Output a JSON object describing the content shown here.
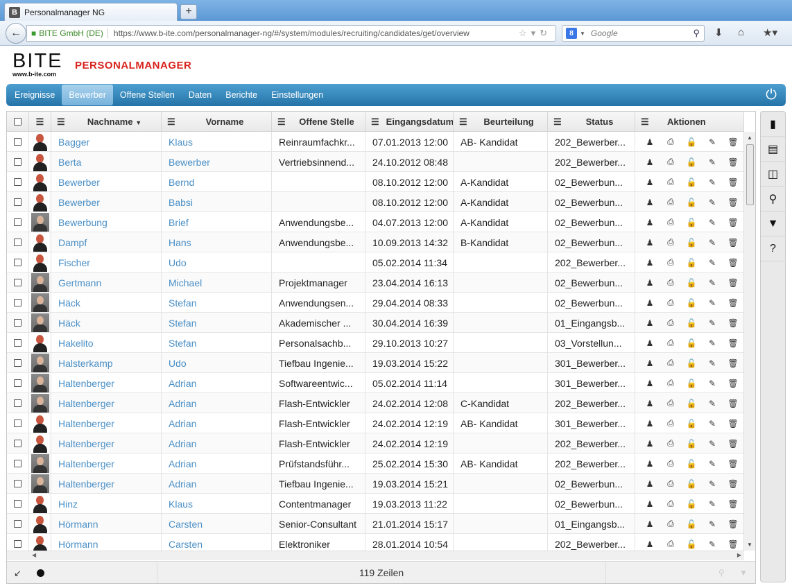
{
  "browser": {
    "tab_title": "Personalmanager NG",
    "favicon_letter": "B",
    "new_tab": "+",
    "site_identity": "BITE GmbH (DE)",
    "url": "https://www.b-ite.com/personalmanager-ng/#/system/modules/recruiting/candidates/get/overview",
    "search_engine_letter": "8",
    "search_placeholder": "Google"
  },
  "header": {
    "logo_main": "BITE",
    "logo_www": "www.b-ite.com",
    "logo_product": "PERSONALMANAGER"
  },
  "menu": {
    "items": [
      "Ereignisse",
      "Bewerber",
      "Offene Stellen",
      "Daten",
      "Berichte",
      "Einstellungen"
    ],
    "active": "Bewerber"
  },
  "columns": {
    "nachname": "Nachname",
    "vorname": "Vorname",
    "offene_stelle": "Offene Stelle",
    "eingangsdatum": "Eingangsdatum",
    "beurteilung": "Beurteilung",
    "status": "Status",
    "aktionen": "Aktionen"
  },
  "rows": [
    {
      "nachname": "Bagger",
      "vorname": "Klaus",
      "stelle": "Reinraumfachkr...",
      "datum": "07.01.2013 12:00",
      "beurteilung": "AB- Kandidat",
      "status": "202_Bewerber...",
      "photo": false
    },
    {
      "nachname": "Berta",
      "vorname": "Bewerber",
      "stelle": "Vertriebsinnend...",
      "datum": "24.10.2012 08:48",
      "beurteilung": "",
      "status": "202_Bewerber...",
      "photo": false
    },
    {
      "nachname": "Bewerber",
      "vorname": "Bernd",
      "stelle": "",
      "datum": "08.10.2012 12:00",
      "beurteilung": "A-Kandidat",
      "status": "02_Bewerbun...",
      "photo": false
    },
    {
      "nachname": "Bewerber",
      "vorname": "Babsi",
      "stelle": "",
      "datum": "08.10.2012 12:00",
      "beurteilung": "A-Kandidat",
      "status": "02_Bewerbun...",
      "photo": false
    },
    {
      "nachname": "Bewerbung",
      "vorname": "Brief",
      "stelle": "Anwendungsbe...",
      "datum": "04.07.2013 12:00",
      "beurteilung": "A-Kandidat",
      "status": "02_Bewerbun...",
      "photo": true
    },
    {
      "nachname": "Dampf",
      "vorname": "Hans",
      "stelle": "Anwendungsbe...",
      "datum": "10.09.2013 14:32",
      "beurteilung": "B-Kandidat",
      "status": "02_Bewerbun...",
      "photo": false
    },
    {
      "nachname": "Fischer",
      "vorname": "Udo",
      "stelle": "",
      "datum": "05.02.2014 11:34",
      "beurteilung": "",
      "status": "202_Bewerber...",
      "photo": false
    },
    {
      "nachname": "Gertmann",
      "vorname": "Michael",
      "stelle": "Projektmanager",
      "datum": "23.04.2014 16:13",
      "beurteilung": "",
      "status": "02_Bewerbun...",
      "photo": true
    },
    {
      "nachname": "Häck",
      "vorname": "Stefan",
      "stelle": "Anwendungsen...",
      "datum": "29.04.2014 08:33",
      "beurteilung": "",
      "status": "02_Bewerbun...",
      "photo": true
    },
    {
      "nachname": "Häck",
      "vorname": "Stefan",
      "stelle": "Akademischer ...",
      "datum": "30.04.2014 16:39",
      "beurteilung": "",
      "status": "01_Eingangsb...",
      "photo": true
    },
    {
      "nachname": "Hakelito",
      "vorname": "Stefan",
      "stelle": "Personalsachb...",
      "datum": "29.10.2013 10:27",
      "beurteilung": "",
      "status": "03_Vorstellun...",
      "photo": false
    },
    {
      "nachname": "Halsterkamp",
      "vorname": "Udo",
      "stelle": "Tiefbau Ingenie...",
      "datum": "19.03.2014 15:22",
      "beurteilung": "",
      "status": "301_Bewerber...",
      "photo": true
    },
    {
      "nachname": "Haltenberger",
      "vorname": "Adrian",
      "stelle": "Softwareentwic...",
      "datum": "05.02.2014 11:14",
      "beurteilung": "",
      "status": "301_Bewerber...",
      "photo": true
    },
    {
      "nachname": "Haltenberger",
      "vorname": "Adrian",
      "stelle": "Flash-Entwickler",
      "datum": "24.02.2014 12:08",
      "beurteilung": "C-Kandidat",
      "status": "202_Bewerber...",
      "photo": true
    },
    {
      "nachname": "Haltenberger",
      "vorname": "Adrian",
      "stelle": "Flash-Entwickler",
      "datum": "24.02.2014 12:19",
      "beurteilung": "AB- Kandidat",
      "status": "301_Bewerber...",
      "photo": false
    },
    {
      "nachname": "Haltenberger",
      "vorname": "Adrian",
      "stelle": "Flash-Entwickler",
      "datum": "24.02.2014 12:19",
      "beurteilung": "",
      "status": "202_Bewerber...",
      "photo": false
    },
    {
      "nachname": "Haltenberger",
      "vorname": "Adrian",
      "stelle": "Prüfstandsführ...",
      "datum": "25.02.2014 15:30",
      "beurteilung": "AB- Kandidat",
      "status": "202_Bewerber...",
      "photo": true
    },
    {
      "nachname": "Haltenberger",
      "vorname": "Adrian",
      "stelle": "Tiefbau Ingenie...",
      "datum": "19.03.2014 15:21",
      "beurteilung": "",
      "status": "02_Bewerbun...",
      "photo": true
    },
    {
      "nachname": "Hinz",
      "vorname": "Klaus",
      "stelle": "Contentmanager",
      "datum": "19.03.2013 11:22",
      "beurteilung": "",
      "status": "02_Bewerbun...",
      "photo": false
    },
    {
      "nachname": "Hörmann",
      "vorname": "Carsten",
      "stelle": "Senior-Consultant",
      "datum": "21.01.2014 15:17",
      "beurteilung": "",
      "status": "01_Eingangsb...",
      "photo": false
    },
    {
      "nachname": "Hörmann",
      "vorname": "Carsten",
      "stelle": "Elektroniker",
      "datum": "28.01.2014 10:54",
      "beurteilung": "",
      "status": "202_Bewerber...",
      "photo": false
    }
  ],
  "footer": {
    "row_count": "119 Zeilen"
  },
  "colors": {
    "menu_bar": "#2f86bf",
    "link": "#4a8fc6",
    "brand_red": "#d9221c"
  },
  "sidebar_icons": [
    "bookmark-icon",
    "layout-rows-icon",
    "columns-icon",
    "search-icon",
    "filter-icon",
    "help-icon"
  ]
}
